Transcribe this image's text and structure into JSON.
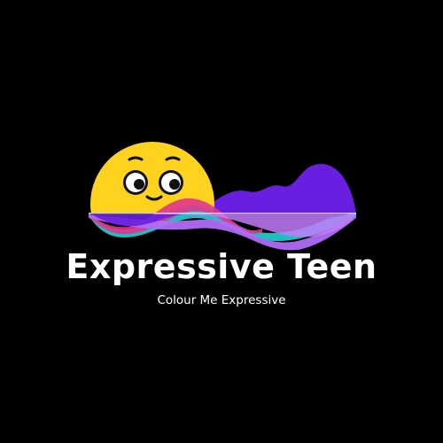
{
  "logo": {
    "icon": "smiling-face-with-sound-wave",
    "colors": {
      "background": "#000000",
      "face": "#FFD21F",
      "wave_purple": "#6A1FE0",
      "wave_violet": "#B06CF5",
      "wave_cyan": "#1FC9C9",
      "wave_pink": "#E0358E",
      "text": "#FFFFFF"
    }
  },
  "brand": {
    "name": "Expressive Teen",
    "tagline": "Colour Me Expressive"
  }
}
